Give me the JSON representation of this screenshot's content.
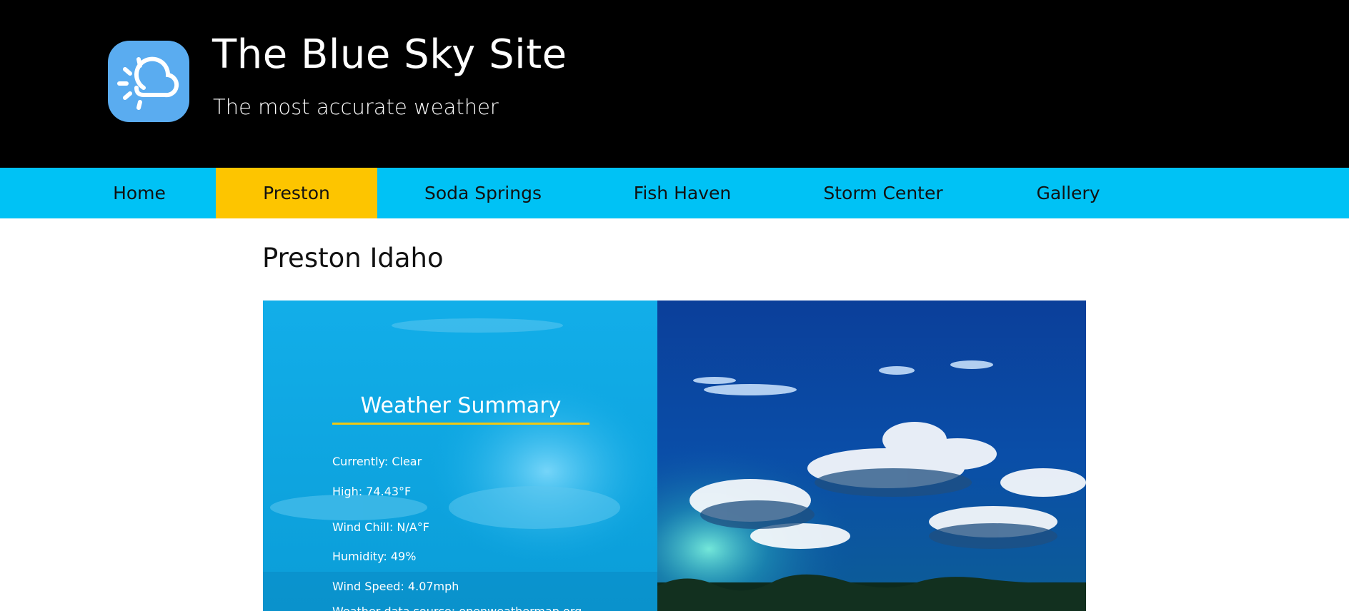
{
  "header": {
    "title": "The Blue Sky Site",
    "tagline": "The most accurate weather",
    "logo_icon": "partly-sunny-cloud-icon"
  },
  "nav": {
    "items": [
      {
        "label": "Home",
        "active": false
      },
      {
        "label": "Preston",
        "active": true
      },
      {
        "label": "Soda Springs",
        "active": false
      },
      {
        "label": "Fish Haven",
        "active": false
      },
      {
        "label": "Storm Center",
        "active": false
      },
      {
        "label": "Gallery",
        "active": false
      }
    ]
  },
  "page": {
    "heading": "Preston Idaho"
  },
  "summary": {
    "title": "Weather Summary",
    "currently": "Currently: Clear",
    "high": "High: 74.43°F",
    "wind_chill": "Wind Chill: N/A°F",
    "humidity": "Humidity: 49%",
    "wind_speed": "Wind Speed: 4.07mph",
    "source": "Weather data source: openweathermap.org"
  },
  "colors": {
    "header_bg": "#000000",
    "nav_bg": "#00c2f5",
    "nav_active": "#fdc500",
    "logo_bg": "#5aacf0",
    "summary_underline": "#f2c811"
  }
}
